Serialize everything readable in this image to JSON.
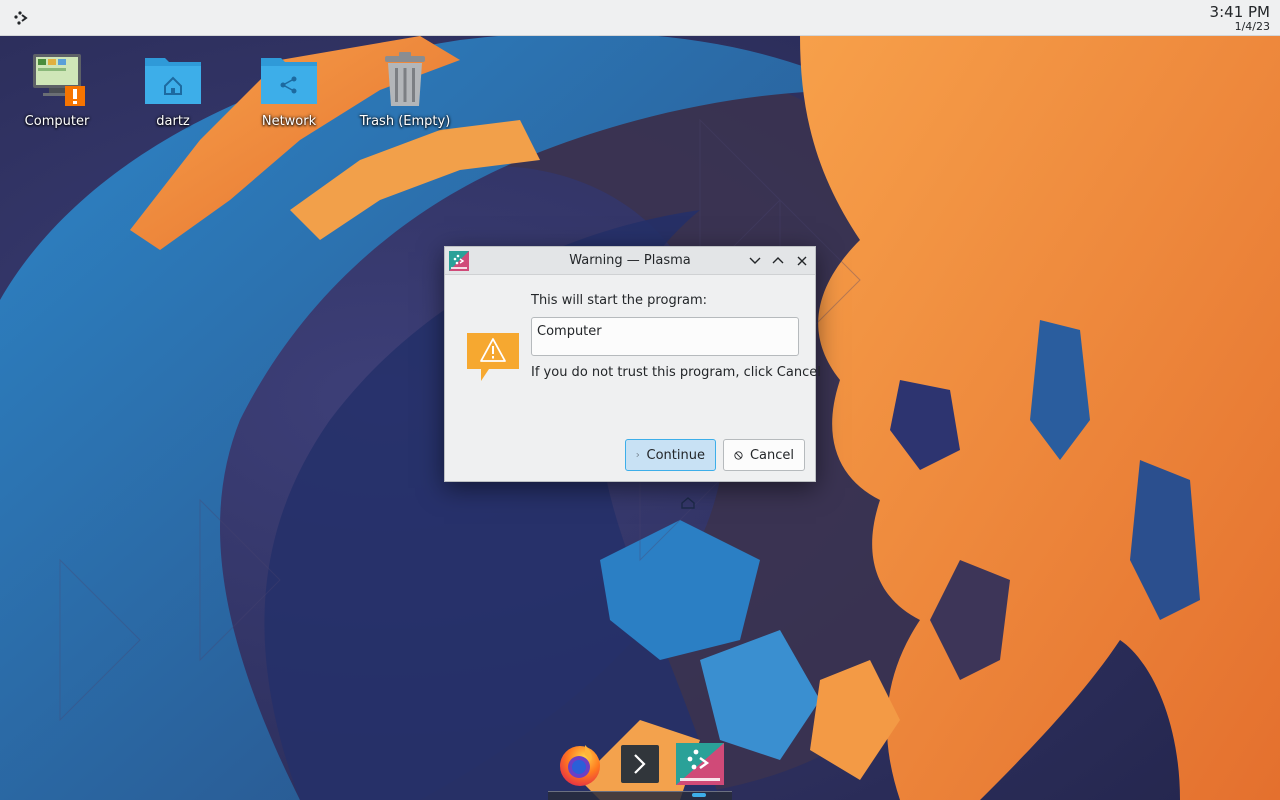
{
  "panel": {
    "launcher_icon": "plasma-launcher-icon",
    "clock_time": "3:41 PM",
    "clock_date": "1/4/23"
  },
  "desktop": {
    "icons": [
      {
        "label": "Computer",
        "icon": "computer-warning-icon"
      },
      {
        "label": "dartz",
        "icon": "home-folder-icon"
      },
      {
        "label": "Network",
        "icon": "network-folder-icon"
      },
      {
        "label": "Trash (Empty)",
        "icon": "trash-icon"
      }
    ]
  },
  "dialog": {
    "title": "Warning — Plasma",
    "message": "This will start the program:",
    "program_value": "Computer",
    "trust_message": "If you do not trust this program, click Cancel",
    "continue_label": "Continue",
    "cancel_label": "Cancel"
  },
  "dock": {
    "items": [
      {
        "name": "Firefox",
        "icon": "firefox-icon"
      },
      {
        "name": "Terminal",
        "icon": "terminal-icon"
      },
      {
        "name": "Plasma",
        "icon": "plasma-app-icon"
      }
    ]
  },
  "colors": {
    "accent": "#3daee9",
    "warning": "#f6a830",
    "panel": "#eff0f1",
    "wallpaper_blue": "#2d6fb0",
    "wallpaper_orange": "#f09040"
  }
}
